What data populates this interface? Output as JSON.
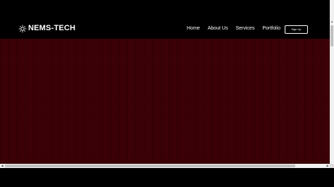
{
  "brand": {
    "name": "NEMS-TECH",
    "icon": "gear-icon"
  },
  "nav": {
    "items": [
      {
        "label": "Home"
      },
      {
        "label": "About Us"
      },
      {
        "label": "Services"
      },
      {
        "label": "Portfolio"
      }
    ],
    "signup_label": "Sign Up"
  },
  "colors": {
    "navbar_bg": "#000000",
    "hero_bg": "#3b0106",
    "text": "#ffffff"
  }
}
